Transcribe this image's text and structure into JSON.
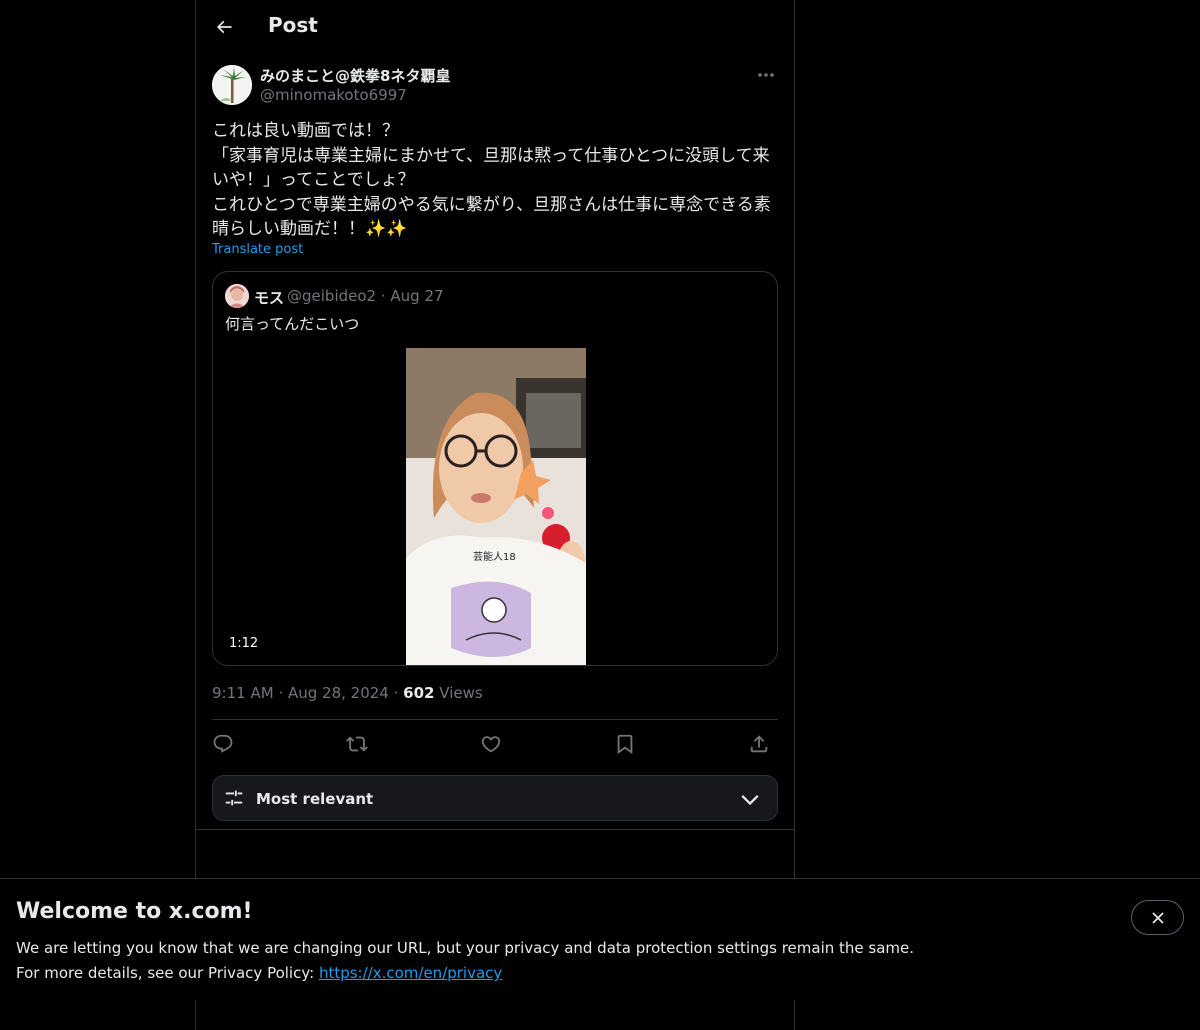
{
  "header": {
    "title": "Post"
  },
  "post": {
    "display_name": "みのまこと@鉄拳8ネタ覇皇",
    "handle": "@minomakoto6997",
    "text": "これは良い動画では！？\n「家事育児は専業主婦にまかせて、旦那は黙って仕事ひとつに没頭して来いや！」ってことでしょ？\nこれひとつで専業主婦のやる気に繋がり、旦那さんは仕事に専念できる素晴らしい動画だ！！✨✨",
    "translate_label": "Translate post",
    "time": "9:11 AM",
    "date": "Aug 28, 2024",
    "views_count": "602",
    "views_label": "Views"
  },
  "quote": {
    "display_name": "モス",
    "meta": "@geibideo2 · Aug 27",
    "text": "何言ってんだこいつ",
    "video_duration": "1:12"
  },
  "actions": {
    "reply_icon": "reply-icon",
    "repost_icon": "repost-icon",
    "like_icon": "heart-icon",
    "bookmark_icon": "bookmark-icon",
    "share_icon": "share-icon"
  },
  "sort": {
    "label": "Most relevant"
  },
  "banner": {
    "title": "Welcome to x.com!",
    "line1": "We are letting you know that we are changing our URL, but your privacy and data protection settings remain the same.",
    "line2_prefix": "For more details, see our Privacy Policy: ",
    "link_text": "https://x.com/en/privacy"
  },
  "colors": {
    "background": "#000000",
    "accent": "#1d9bf0",
    "border": "#2f3336",
    "muted_text": "#71767b"
  }
}
